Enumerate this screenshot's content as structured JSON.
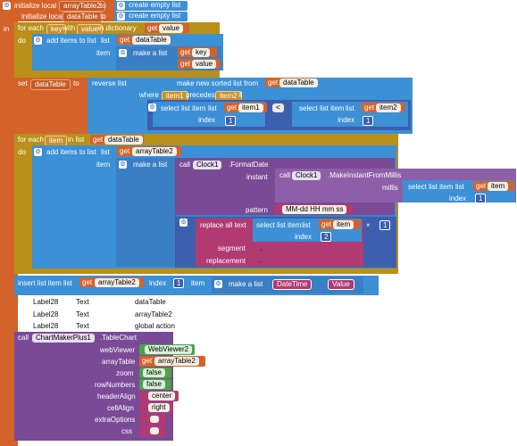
{
  "init": [
    {
      "kw": "initialize local",
      "var": "arrayTable2",
      "to": "to",
      "val": "create empty list"
    },
    {
      "kw": "initialize local",
      "var": "dataTable",
      "to": "to",
      "val": "create empty list"
    }
  ],
  "in_label": "in",
  "foreach1": {
    "kw": "for each",
    "key": "key",
    "with": "with",
    "value": "value",
    "in": "in dictionary",
    "get": "get",
    "getvar": "value"
  },
  "do_label": "do",
  "add1": {
    "kw": "add items to list",
    "list": "list",
    "get": "get",
    "listvar": "dataTable",
    "item": "item",
    "make": "make a list",
    "g1": "key",
    "g2": "value"
  },
  "set1": {
    "kw": "set",
    "var": "dataTable",
    "to": "to",
    "reverse": "reverse list",
    "sorted": "make new sorted list from",
    "get": "get",
    "getvar": "dataTable",
    "where": "where",
    "a": "item1",
    "precedes": "precedes",
    "b": "item2",
    "if": "if"
  },
  "select": {
    "kw": "select list item",
    "list": "list",
    "index": "index",
    "a": "item1",
    "b": "item2",
    "op": "<",
    "n": "1"
  },
  "foreach2": {
    "kw": "for each",
    "var": "item",
    "in": "in list",
    "get": "get",
    "getvar": "dataTable"
  },
  "add2": {
    "kw": "add items to list",
    "list": "list",
    "get": "get",
    "listvar": "arrayTable2",
    "item": "item",
    "make": "make a list"
  },
  "clock": {
    "call": "call",
    "comp": "Clock1",
    "method": ".FormatDate",
    "instant": "instant",
    "call2": "call",
    "comp2": "Clock1",
    "method2": ".MakeInstantFromMillis",
    "millis": "millis",
    "sel": "select list item",
    "list": "list",
    "get": "get",
    "getvar": "item",
    "index": "index",
    "n1": "1",
    "pattern": "pattern",
    "patval": "MM-dd HH mm ss"
  },
  "replace": {
    "kw": "replace all text",
    "sel": "select list item",
    "list": "list",
    "get": "get",
    "getvar": "item",
    "index": "index",
    "n2": "2",
    "times": "×",
    "n3": "1",
    "segment": "segment",
    "seg": ",",
    "replacement": "replacement",
    "rep": "."
  },
  "insert": {
    "kw": "insert list item",
    "list": "list",
    "get": "get",
    "getvar": "arrayTable2",
    "index": "index",
    "n": "1",
    "item": "item",
    "make": "make a list",
    "v1": "DateTime",
    "v2": "Value"
  },
  "labels": [
    {
      "comp": "Label28",
      "prop": "Text",
      "val": "dataTable"
    },
    {
      "comp": "Label28",
      "prop": "Text",
      "val": "arrayTable2"
    },
    {
      "comp": "Label28",
      "prop": "Text",
      "val": "global action"
    }
  ],
  "chart": {
    "call": "call",
    "comp": "ChartMakerPlus1",
    "method": ".TableChart",
    "webViewer": "webViewer",
    "wv": "WebViewer2",
    "arrayTable": "arrayTable",
    "get": "get",
    "getvar": "arrayTable2",
    "zoom": "zoom",
    "zv": "false",
    "rowNumbers": "rowNumbers",
    "rv": "false",
    "headerAlign": "headerAlign",
    "hv": "center",
    "cellAlign": "cellAlign",
    "cv": "right",
    "extraOptions": "extraOptions",
    "css": "css"
  }
}
